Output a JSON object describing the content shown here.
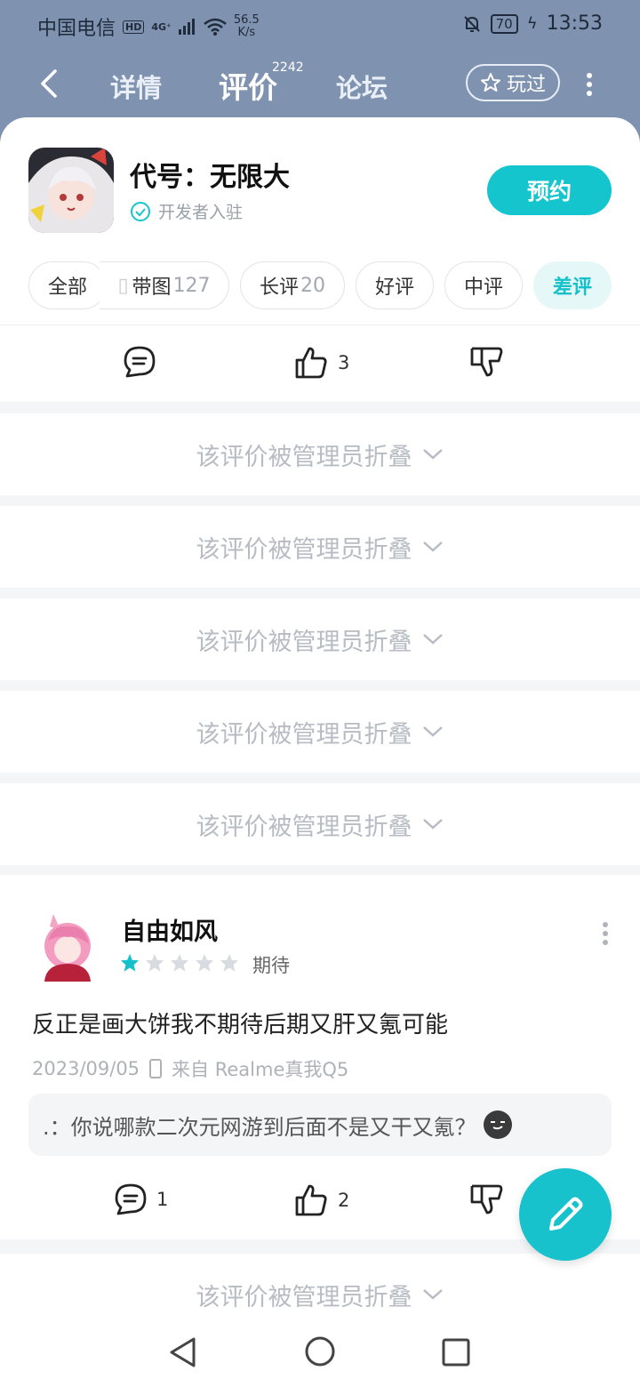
{
  "status_bar": {
    "carrier": "中国电信",
    "hd": "HD",
    "signal_tag": "4G⁺",
    "net_speed": "56.5",
    "net_unit": "K/s",
    "battery": "70",
    "time": "13:53"
  },
  "nav": {
    "tabs": [
      {
        "label": "详情"
      },
      {
        "label": "评价"
      },
      {
        "label": "论坛"
      }
    ],
    "active_tab": "评价",
    "review_count": "2242",
    "played_label": "玩过"
  },
  "game": {
    "title": "代号：无限大",
    "developer_label": "开发者入驻",
    "reserve_label": "预约"
  },
  "filters": [
    {
      "label": "全部",
      "count": ""
    },
    {
      "label": "带图",
      "count": "127"
    },
    {
      "label": "长评",
      "count": "20"
    },
    {
      "label": "好评",
      "count": ""
    },
    {
      "label": "中评",
      "count": ""
    },
    {
      "label": "差评",
      "count": ""
    }
  ],
  "top_actions": {
    "likes": "3"
  },
  "folded_text": "该评价被管理员折叠",
  "review": {
    "user": "自由如风",
    "rating": 1,
    "rating_max": 5,
    "rating_label": "期待",
    "text": "反正是画大饼我不期待后期又肝又氪可能",
    "date": "2023/09/05",
    "device": "来自 Realme真我Q5",
    "reply": ".：你说哪款二次元网游到后面不是又干又氪？",
    "comments": "1",
    "likes": "2"
  },
  "colors": {
    "accent": "#15c5ce",
    "header_bg": "#7f93b1",
    "star_on": "#14c0c9",
    "star_off": "#d8dbe0"
  }
}
